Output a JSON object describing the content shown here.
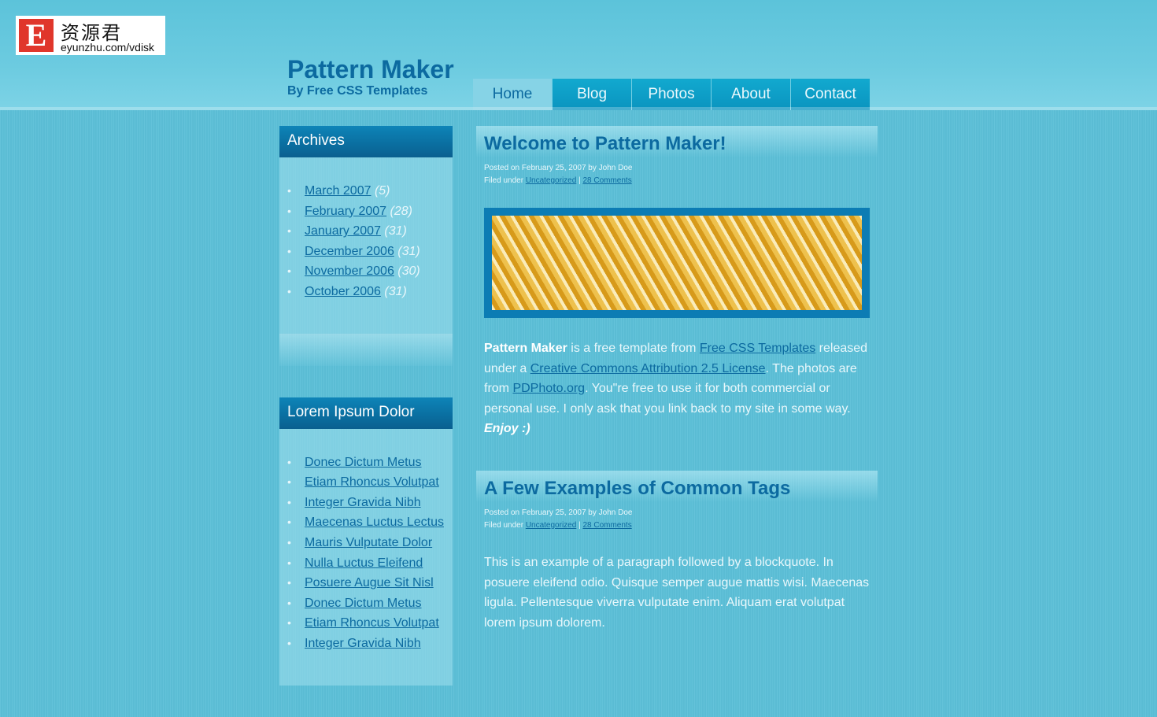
{
  "watermark": {
    "letter": "E",
    "chinese": "资源君",
    "url": "eyunzhu.com/vdisk"
  },
  "site": {
    "title": "Pattern Maker",
    "subtitle": "By Free CSS Templates"
  },
  "nav": {
    "items": [
      {
        "label": "Home",
        "active": true
      },
      {
        "label": "Blog"
      },
      {
        "label": "Photos"
      },
      {
        "label": "About"
      },
      {
        "label": "Contact"
      }
    ]
  },
  "sidebar": {
    "archives": {
      "title": "Archives",
      "items": [
        {
          "label": "March 2007",
          "count": "(5)"
        },
        {
          "label": "February 2007",
          "count": "(28)"
        },
        {
          "label": "January 2007",
          "count": "(31)"
        },
        {
          "label": "December 2006",
          "count": "(31)"
        },
        {
          "label": "November 2006",
          "count": "(30)"
        },
        {
          "label": "October 2006",
          "count": "(31)"
        }
      ]
    },
    "lorem": {
      "title": "Lorem Ipsum Dolor",
      "items": [
        "Donec Dictum Metus",
        "Etiam Rhoncus Volutpat",
        "Integer Gravida Nibh",
        "Maecenas Luctus Lectus",
        "Mauris Vulputate Dolor",
        "Nulla Luctus Eleifend",
        "Posuere Augue Sit Nisl",
        "Donec Dictum Metus",
        "Etiam Rhoncus Volutpat",
        "Integer Gravida Nibh"
      ]
    }
  },
  "posts": [
    {
      "title": "Welcome to Pattern Maker!",
      "posted": "Posted on February 25, 2007 by John Doe",
      "filed_prefix": "Filed under ",
      "category": "Uncategorized",
      "separator": " | ",
      "comments": "28 Comments",
      "body": {
        "bold_name": "Pattern Maker",
        "t1": " is a free template from ",
        "link1": "Free CSS Templates",
        "t2": " released under a ",
        "link2": "Creative Commons Attribution 2.5 License",
        "t3": ". The photos are from ",
        "link3": "PDPhoto.org",
        "t4": ". You\"re free to use it for both commercial or personal use. I only ask that you link back to my site in some way. ",
        "enjoy": "Enjoy :)"
      }
    },
    {
      "title": "A Few Examples of Common Tags",
      "posted": "Posted on February 25, 2007 by John Doe",
      "filed_prefix": "Filed under ",
      "category": "Uncategorized",
      "separator": " | ",
      "comments": "28 Comments",
      "body_text": "This is an example of a paragraph followed by a blockquote. In posuere eleifend odio. Quisque semper augue mattis wisi. Maecenas ligula. Pellentesque viverra vulputate enim. Aliquam erat volutpat lorem ipsum dolorem."
    }
  ]
}
